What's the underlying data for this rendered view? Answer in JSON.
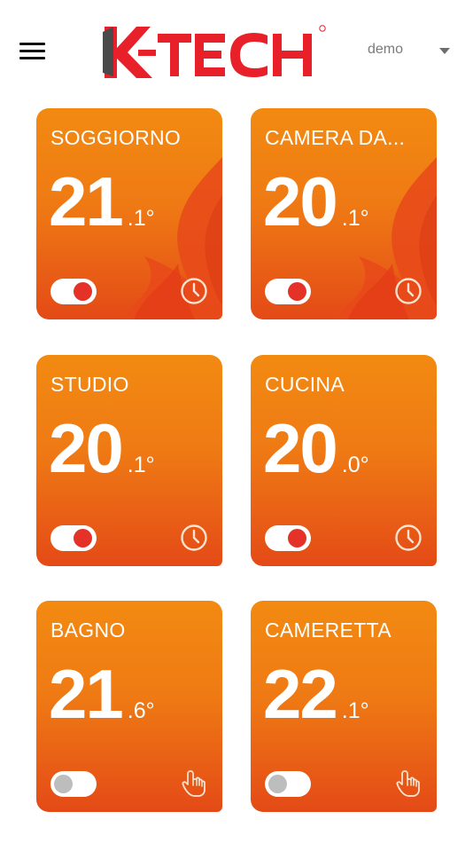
{
  "header": {
    "brand": "K-TECH",
    "user": "demo"
  },
  "zones": [
    {
      "name": "SOGGIORNO",
      "temp_int": "21",
      "temp_dec": ".1°",
      "enabled": true,
      "mode": "schedule-clock-icon",
      "heating": true
    },
    {
      "name": "CAMERA DA...",
      "temp_int": "20",
      "temp_dec": ".1°",
      "enabled": true,
      "mode": "schedule-clock-icon",
      "heating": true
    },
    {
      "name": "STUDIO",
      "temp_int": "20",
      "temp_dec": ".1°",
      "enabled": true,
      "mode": "schedule-clock-icon",
      "heating": false
    },
    {
      "name": "CUCINA",
      "temp_int": "20",
      "temp_dec": ".0°",
      "enabled": true,
      "mode": "schedule-clock-icon",
      "heating": false
    },
    {
      "name": "BAGNO",
      "temp_int": "21",
      "temp_dec": ".6°",
      "enabled": false,
      "mode": "manual-hand-icon",
      "heating": false
    },
    {
      "name": "CAMERETTA",
      "temp_int": "22",
      "temp_dec": ".1°",
      "enabled": false,
      "mode": "manual-hand-icon",
      "heating": false
    }
  ],
  "colors": {
    "card_top": "#f28a11",
    "card_bottom": "#e44a17",
    "toggle_on": "#e53228",
    "toggle_off": "#bdbdbd",
    "brand_red": "#e8202a"
  }
}
